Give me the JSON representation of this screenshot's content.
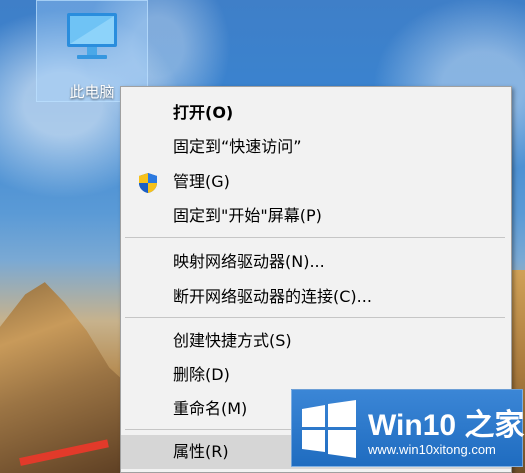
{
  "desktop": {
    "icon_label": "此电脑"
  },
  "context_menu": {
    "items": [
      {
        "label": "打开(O)"
      },
      {
        "label": "固定到“快速访问”"
      },
      {
        "label": "管理(G)"
      },
      {
        "label": "固定到\"开始\"屏幕(P)"
      },
      {
        "label": "映射网络驱动器(N)..."
      },
      {
        "label": "断开网络驱动器的连接(C)..."
      },
      {
        "label": "创建快捷方式(S)"
      },
      {
        "label": "删除(D)"
      },
      {
        "label": "重命名(M)"
      },
      {
        "label": "属性(R)"
      }
    ]
  },
  "watermark": {
    "title": "Win10 之家",
    "url": "www.win10xitong.com"
  },
  "colors": {
    "menu_bg": "#f2f2f2",
    "menu_selected": "#d6d6d6",
    "watermark_bg": "#1f6cc0"
  },
  "icons": [
    "this-pc-icon",
    "uac-shield-icon",
    "windows-logo"
  ]
}
